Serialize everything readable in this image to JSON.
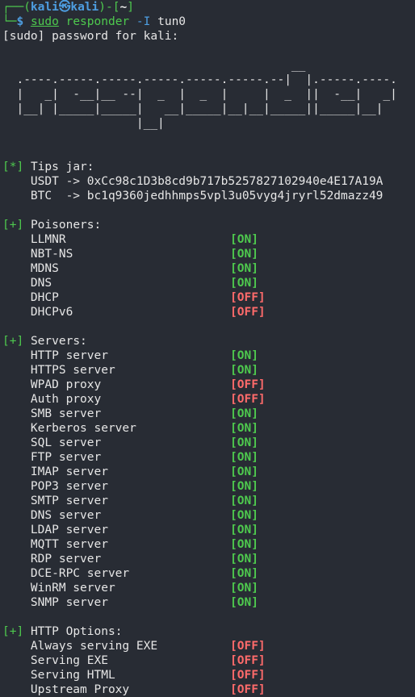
{
  "prompt": {
    "corner_top": "┌──(",
    "user": "kali",
    "skull": "㉿",
    "host": "kali",
    "mid": ")-[",
    "path": "~",
    "end": "]",
    "corner_bottom": "└─",
    "dollar": "$",
    "cmd_sudo": "sudo",
    "cmd_tool": "responder",
    "cmd_flag": "-I",
    "cmd_arg": "tun0"
  },
  "sudo_prompt": "[sudo] password for kali:",
  "ascii_art": [
    "                                         __",
    "  .----.-----.-----.-----.-----.-----.--|  |.-----.----.",
    "  |   _|  -__|__ --|  _  |  _  |     |  _  ||  -__|   _|",
    "  |__| |_____|_____|   __|_____|__|__|_____||_____|__|",
    "                   |__|"
  ],
  "tips": {
    "marker": "[*]",
    "title": "Tips jar:",
    "usdt_label": "USDT -> ",
    "usdt": "0xCc98c1D3b8cd9b717b5257827102940e4E17A19A",
    "btc_label": "BTC  -> ",
    "btc": "bc1q9360jedhhmps5vpl3u05vyg4jryrl52dmazz49"
  },
  "poisoners": {
    "marker": "[+]",
    "title": "Poisoners:",
    "items": [
      {
        "name": "LLMNR",
        "status": "[ON]",
        "on": true
      },
      {
        "name": "NBT-NS",
        "status": "[ON]",
        "on": true
      },
      {
        "name": "MDNS",
        "status": "[ON]",
        "on": true
      },
      {
        "name": "DNS",
        "status": "[ON]",
        "on": true
      },
      {
        "name": "DHCP",
        "status": "[OFF]",
        "on": false
      },
      {
        "name": "DHCPv6",
        "status": "[OFF]",
        "on": false
      }
    ]
  },
  "servers": {
    "marker": "[+]",
    "title": "Servers:",
    "items": [
      {
        "name": "HTTP server",
        "status": "[ON]",
        "on": true
      },
      {
        "name": "HTTPS server",
        "status": "[ON]",
        "on": true
      },
      {
        "name": "WPAD proxy",
        "status": "[OFF]",
        "on": false
      },
      {
        "name": "Auth proxy",
        "status": "[OFF]",
        "on": false
      },
      {
        "name": "SMB server",
        "status": "[ON]",
        "on": true
      },
      {
        "name": "Kerberos server",
        "status": "[ON]",
        "on": true
      },
      {
        "name": "SQL server",
        "status": "[ON]",
        "on": true
      },
      {
        "name": "FTP server",
        "status": "[ON]",
        "on": true
      },
      {
        "name": "IMAP server",
        "status": "[ON]",
        "on": true
      },
      {
        "name": "POP3 server",
        "status": "[ON]",
        "on": true
      },
      {
        "name": "SMTP server",
        "status": "[ON]",
        "on": true
      },
      {
        "name": "DNS server",
        "status": "[ON]",
        "on": true
      },
      {
        "name": "LDAP server",
        "status": "[ON]",
        "on": true
      },
      {
        "name": "MQTT server",
        "status": "[ON]",
        "on": true
      },
      {
        "name": "RDP server",
        "status": "[ON]",
        "on": true
      },
      {
        "name": "DCE-RPC server",
        "status": "[ON]",
        "on": true
      },
      {
        "name": "WinRM server",
        "status": "[ON]",
        "on": true
      },
      {
        "name": "SNMP server",
        "status": "[ON]",
        "on": true
      }
    ]
  },
  "http_options": {
    "marker": "[+]",
    "title": "HTTP Options:",
    "items": [
      {
        "name": "Always serving EXE",
        "status": "[OFF]",
        "on": false
      },
      {
        "name": "Serving EXE",
        "status": "[OFF]",
        "on": false
      },
      {
        "name": "Serving HTML",
        "status": "[OFF]",
        "on": false
      },
      {
        "name": "Upstream Proxy",
        "status": "[OFF]",
        "on": false
      }
    ]
  },
  "colors": {
    "background": "#282c34",
    "on": "#4ec94e",
    "off": "#ff6b6b",
    "prompt_blue": "#4d9de0"
  }
}
